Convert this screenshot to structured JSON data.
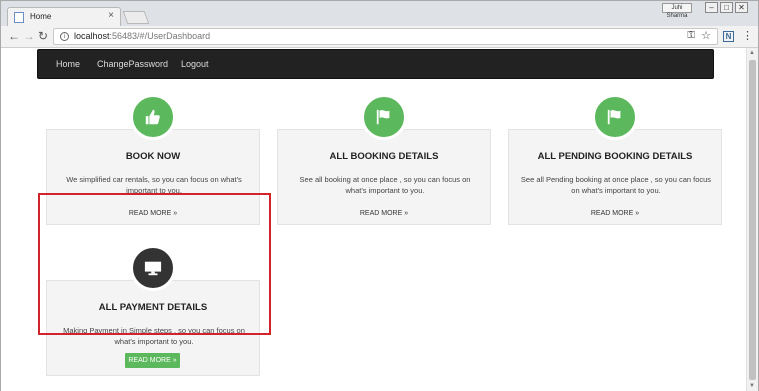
{
  "browser": {
    "tab_title": "Home",
    "tab_close": "×",
    "user_badge": "Juhi Sharma",
    "url_host": "localhost",
    "url_path": ":56483/#/UserDashboard",
    "menu_glyph": "⋮",
    "ext_label": "N"
  },
  "nav": {
    "items": [
      "Home",
      "ChangePassword",
      "Logout"
    ]
  },
  "cards": [
    {
      "title": "BOOK NOW",
      "text": "We simplified car rentals, so you can focus on what's important to you.",
      "link": "READ MORE »",
      "icon": "thumbs-up-icon"
    },
    {
      "title": "ALL BOOKING DETAILS",
      "text": "See all booking at once place , so you can focus on what's important to you.",
      "link": "READ MORE »",
      "icon": "flag-icon"
    },
    {
      "title": "ALL PENDING BOOKING DETAILS",
      "text": "See all Pending booking at once place , so you can focus on what's important to you.",
      "link": "READ MORE »",
      "icon": "flag-icon"
    },
    {
      "title": "ALL PAYMENT DETAILS",
      "text": "Making Payment in Simple steps , so you can focus on what's important to you.",
      "link": "READ MORE »",
      "icon": "monitor-icon"
    }
  ],
  "colors": {
    "accent_green": "#5cb85c",
    "navbar_bg": "#222222",
    "highlight_border": "#d0232a"
  }
}
